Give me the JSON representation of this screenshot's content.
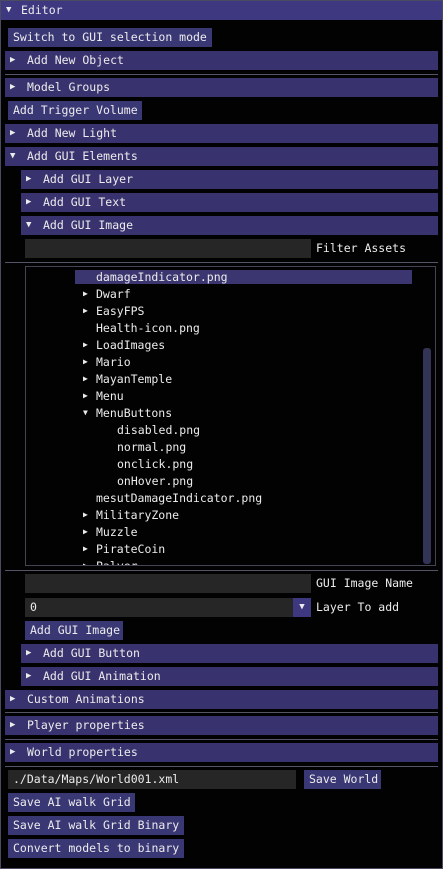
{
  "window": {
    "title": "Editor"
  },
  "buttons": {
    "switch_mode": "Switch to GUI selection mode",
    "add_trigger_volume": "Add Trigger Volume",
    "add_gui_image": "Add GUI Image",
    "save_world": "Save World",
    "save_ai_grid": "Save AI walk Grid",
    "save_ai_grid_binary": "Save AI walk Grid Binary",
    "convert_models": "Convert models to binary"
  },
  "headers": {
    "add_new_object": "Add New Object",
    "model_groups": "Model Groups",
    "add_new_light": "Add New Light",
    "add_gui_elements": "Add GUI Elements",
    "add_gui_layer": "Add GUI Layer",
    "add_gui_text": "Add GUI Text",
    "add_gui_image": "Add GUI Image",
    "add_gui_button": "Add GUI Button",
    "add_gui_animation": "Add GUI Animation",
    "custom_animations": "Custom Animations",
    "player_properties": "Player properties",
    "world_properties": "World properties"
  },
  "filter": {
    "value": "",
    "label": "Filter Assets"
  },
  "assets": [
    {
      "label": "damageIndicator.png",
      "folder": false,
      "open": false,
      "depth": 0,
      "selected": true
    },
    {
      "label": "Dwarf",
      "folder": true,
      "open": false,
      "depth": 0
    },
    {
      "label": "EasyFPS",
      "folder": true,
      "open": false,
      "depth": 0
    },
    {
      "label": "Health-icon.png",
      "folder": false,
      "open": false,
      "depth": 0
    },
    {
      "label": "LoadImages",
      "folder": true,
      "open": false,
      "depth": 0
    },
    {
      "label": "Mario",
      "folder": true,
      "open": false,
      "depth": 0
    },
    {
      "label": "MayanTemple",
      "folder": true,
      "open": false,
      "depth": 0
    },
    {
      "label": "Menu",
      "folder": true,
      "open": false,
      "depth": 0
    },
    {
      "label": "MenuButtons",
      "folder": true,
      "open": true,
      "depth": 0
    },
    {
      "label": "disabled.png",
      "folder": false,
      "open": false,
      "depth": 1
    },
    {
      "label": "normal.png",
      "folder": false,
      "open": false,
      "depth": 1
    },
    {
      "label": "onclick.png",
      "folder": false,
      "open": false,
      "depth": 1
    },
    {
      "label": "onHover.png",
      "folder": false,
      "open": false,
      "depth": 1
    },
    {
      "label": "mesutDamageIndicator.png",
      "folder": false,
      "open": false,
      "depth": 0
    },
    {
      "label": "MilitaryZone",
      "folder": true,
      "open": false,
      "depth": 0
    },
    {
      "label": "Muzzle",
      "folder": true,
      "open": false,
      "depth": 0
    },
    {
      "label": "PirateCoin",
      "folder": true,
      "open": false,
      "depth": 0
    },
    {
      "label": "Palyer",
      "folder": true,
      "open": false,
      "depth": 0
    }
  ],
  "gui_image_name": {
    "value": "",
    "label": "GUI Image Name"
  },
  "layer_to_add": {
    "value": "0",
    "label": "Layer To add"
  },
  "world_path": {
    "value": "./Data/Maps/World001.xml"
  },
  "icons": {
    "collapsed": "▶",
    "expanded": "▼"
  },
  "colors": {
    "title_bar": "#3d3880",
    "header": "#38336e",
    "button": "#3a3775",
    "field": "#262626",
    "background": "#020202"
  }
}
